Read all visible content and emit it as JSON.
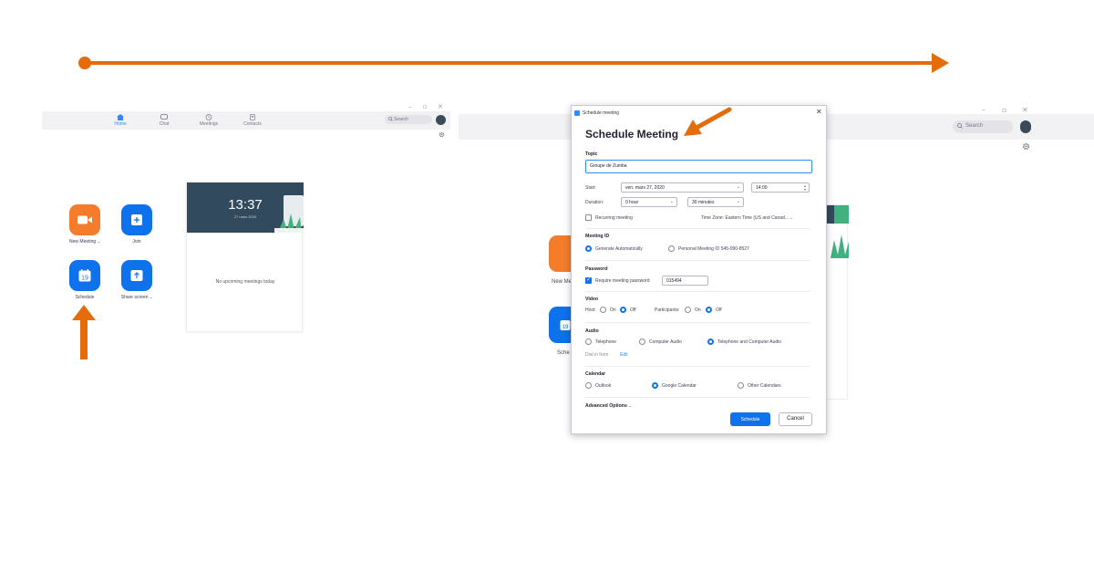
{
  "colors": {
    "accent_orange": "#e46c0a",
    "zoom_blue": "#0e72ed",
    "zoom_orange": "#f47c2a",
    "header_slate": "#314a5e"
  },
  "left_window": {
    "nav": [
      {
        "label": "Home",
        "icon": "home-icon"
      },
      {
        "label": "Chat",
        "icon": "chat-icon"
      },
      {
        "label": "Meetings",
        "icon": "clock-icon"
      },
      {
        "label": "Contacts",
        "icon": "contacts-icon"
      }
    ],
    "search_placeholder": "Search",
    "actions": {
      "new_meeting": "New Meeting",
      "join": "Join",
      "schedule": "Schedule",
      "share_screen": "Share screen"
    },
    "calendar_day": "19",
    "card": {
      "time": "13:37",
      "date": "27 mars 2020",
      "empty_text": "No upcoming meetings today"
    }
  },
  "right_window": {
    "search_placeholder": "Search",
    "partial_labels": {
      "new_meeting": "New Me",
      "schedule": "Sche"
    }
  },
  "dialog": {
    "window_title": "Schedule meeting",
    "heading": "Schedule Meeting",
    "topic": {
      "label": "Topic",
      "value": "Groupe de Zumba"
    },
    "start": {
      "label": "Start:",
      "date": "ven. mars 27, 2020",
      "time": "14:00"
    },
    "duration": {
      "label": "Duration:",
      "hours": "0 hour",
      "minutes": "30 minutes"
    },
    "recurring": "Recurring meeting",
    "timezone": "Time Zone: Eastern Time (US and Canad...",
    "meeting_id": {
      "label": "Meeting ID",
      "auto": "Generate Automatically",
      "personal": "Personal Meeting ID 545-090-8527"
    },
    "password": {
      "label": "Password",
      "require": "Require meeting password",
      "value": "015494"
    },
    "video": {
      "label": "Video",
      "host": "Host:",
      "participants": "Participants:",
      "on": "On",
      "off": "Off"
    },
    "audio": {
      "label": "Audio",
      "telephone": "Telephone",
      "computer": "Computer Audio",
      "both": "Telephone and Computer Audio",
      "dial_in": "Dial in from",
      "edit": "Edit"
    },
    "calendar": {
      "label": "Calendar",
      "outlook": "Outlook",
      "google": "Google Calendar",
      "other": "Other Calendars"
    },
    "advanced": "Advanced Options",
    "schedule_button": "Schedule",
    "cancel_button": "Cancel"
  }
}
